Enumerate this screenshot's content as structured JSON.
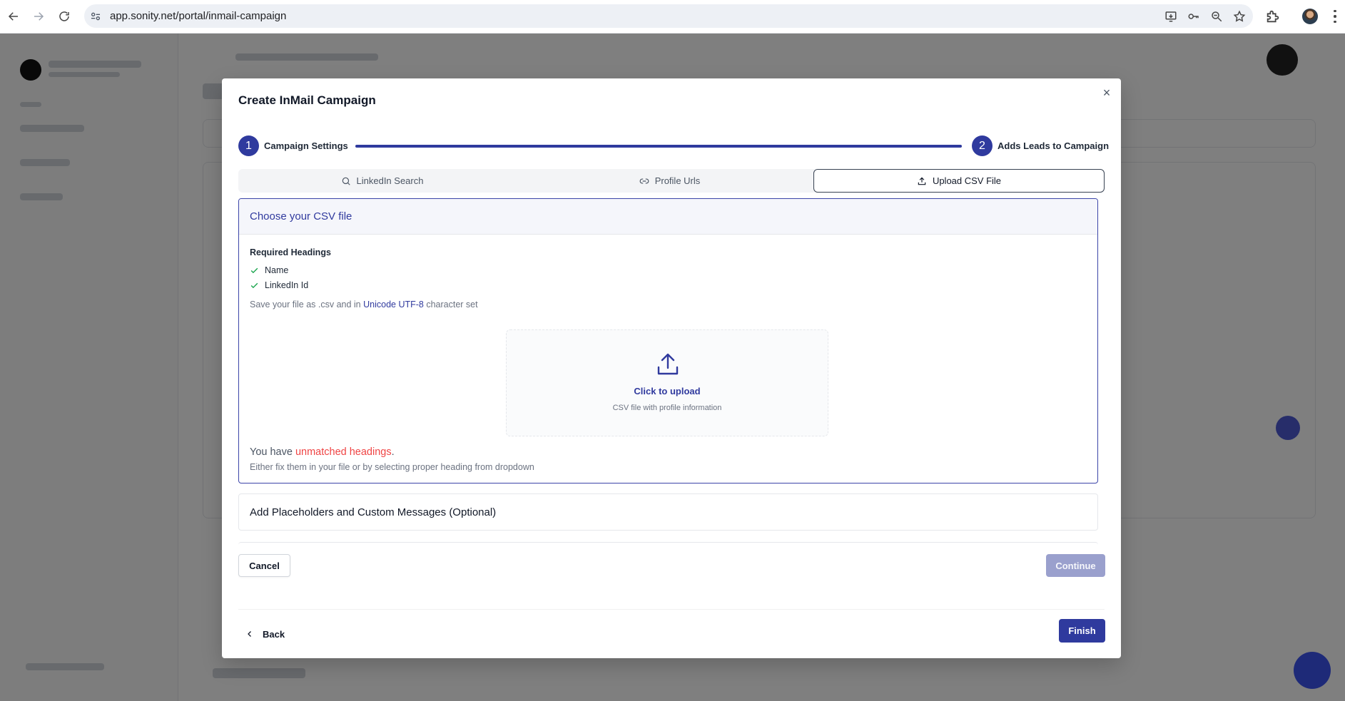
{
  "browser": {
    "url": "app.sonity.net/portal/inmail-campaign"
  },
  "modal": {
    "title": "Create InMail Campaign",
    "close_label": "×",
    "steps": [
      {
        "number": "1",
        "label": "Campaign Settings"
      },
      {
        "number": "2",
        "label": "Adds Leads to Campaign"
      }
    ],
    "tabs": [
      {
        "label": "LinkedIn Search"
      },
      {
        "label": "Profile Urls"
      },
      {
        "label": "Upload CSV File"
      }
    ],
    "csv": {
      "header": "Choose your CSV file",
      "required_title": "Required Headings",
      "required_items": [
        "Name",
        "LinkedIn Id"
      ],
      "save_note_prefix": "Save your file as .csv and in ",
      "save_note_link": "Unicode UTF-8",
      "save_note_suffix": " character set",
      "upload_label": "Click to upload",
      "upload_sub": "CSV file with profile information",
      "unmatched_prefix": "You have ",
      "unmatched_warn": "unmatched headings",
      "unmatched_suffix": ".",
      "fix_note": "Either fix them in your file or by selecting proper heading from dropdown"
    },
    "placeholders_title": "Add Placeholders and Custom Messages (Optional)",
    "cancel_label": "Cancel",
    "continue_label": "Continue",
    "back_label": "Back",
    "finish_label": "Finish"
  },
  "colors": {
    "primary": "#2f3a9e",
    "primary_disabled": "#9aa0cd",
    "warning": "#ef4444",
    "success": "#16a34a"
  }
}
